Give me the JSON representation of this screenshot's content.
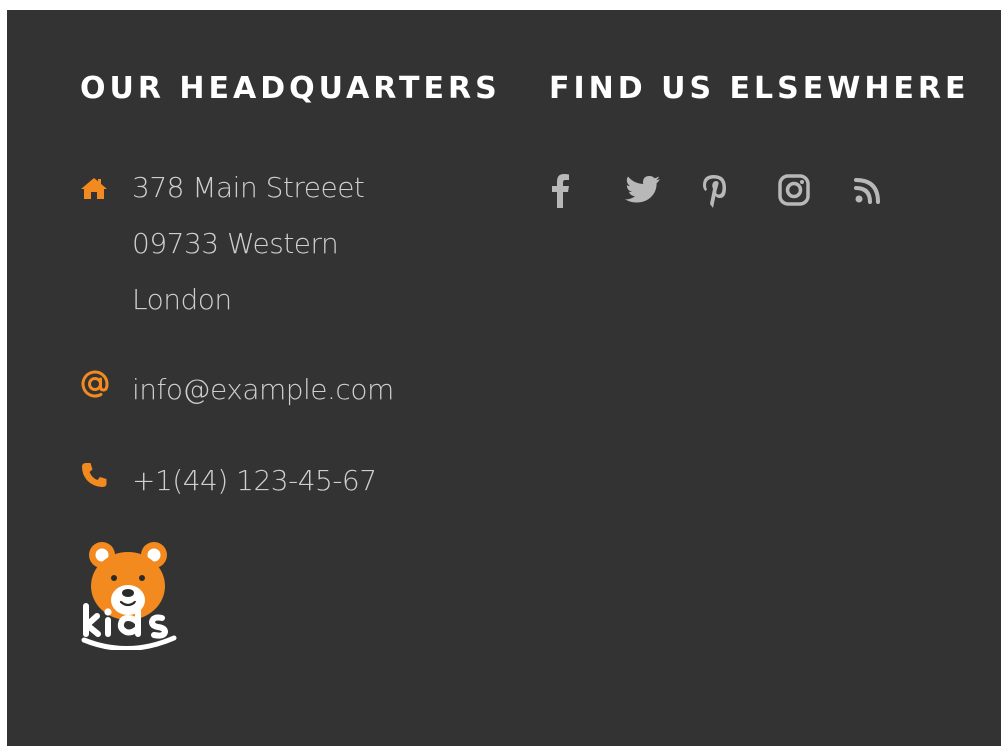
{
  "headquarters": {
    "heading": "OUR HEADQUARTERS",
    "address": {
      "icon": "home-icon",
      "line1": "378 Main Streeet",
      "line2": "09733 Western",
      "line3": "London"
    },
    "email": {
      "icon": "at-icon",
      "value": "info@example.com"
    },
    "phone": {
      "icon": "phone-icon",
      "value": "+1(44) 123-45-67"
    }
  },
  "elsewhere": {
    "heading": "FIND US ELSEWHERE",
    "socials": [
      {
        "icon": "facebook-icon"
      },
      {
        "icon": "twitter-icon"
      },
      {
        "icon": "pinterest-icon"
      },
      {
        "icon": "instagram-icon"
      },
      {
        "icon": "rss-icon"
      }
    ]
  },
  "logo": {
    "text": "kids",
    "icon": "bear-logo"
  },
  "colors": {
    "background": "#333333",
    "accent": "#f28a1f",
    "heading": "#ffffff",
    "text": "#cfcfcf",
    "social": "#b8b8b8"
  }
}
